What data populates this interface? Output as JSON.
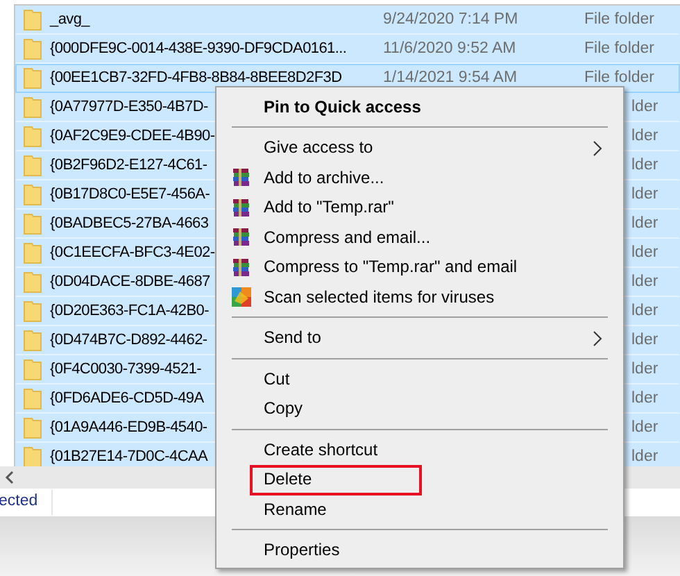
{
  "files": [
    {
      "name": "_avg_",
      "date": "9/24/2020 7:14 PM",
      "type": "File folder",
      "selected": true,
      "focused": false
    },
    {
      "name": "{000DFE9C-0014-438E-9390-DF9CDA0161...",
      "date": "11/6/2020 9:52 AM",
      "type": "File folder",
      "selected": true,
      "focused": false
    },
    {
      "name": "{00EE1CB7-32FD-4FB8-8B84-8BEE8D2F3D",
      "date": "1/14/2021 9:54 AM",
      "type": "File folder",
      "selected": true,
      "focused": true
    },
    {
      "name": "{0A77977D-E350-4B7D-",
      "type": "lder",
      "selected": true,
      "focused": false
    },
    {
      "name": "{0AF2C9E9-CDEE-4B90-",
      "type": "lder",
      "selected": true,
      "focused": false
    },
    {
      "name": "{0B2F96D2-E127-4C61-",
      "type": "lder",
      "selected": true,
      "focused": false
    },
    {
      "name": "{0B17D8C0-E5E7-456A-",
      "type": "lder",
      "selected": true,
      "focused": false
    },
    {
      "name": "{0BADBEC5-27BA-4663",
      "type": "lder",
      "selected": true,
      "focused": false
    },
    {
      "name": "{0C1EECFA-BFC3-4E02-",
      "type": "lder",
      "selected": true,
      "focused": false
    },
    {
      "name": "{0D04DACE-8DBE-4687",
      "type": "lder",
      "selected": true,
      "focused": false
    },
    {
      "name": "{0D20E363-FC1A-42B0-",
      "type": "lder",
      "selected": true,
      "focused": false
    },
    {
      "name": "{0D474B7C-D892-4462-",
      "type": "lder",
      "selected": true,
      "focused": false
    },
    {
      "name": "{0F4C0030-7399-4521-",
      "type": "lder",
      "selected": true,
      "focused": false
    },
    {
      "name": "{0FD6ADE6-CD5D-49A",
      "type": "lder",
      "selected": true,
      "focused": false
    },
    {
      "name": "{01A9A446-ED9B-4540-",
      "type": "lder",
      "selected": true,
      "focused": false
    },
    {
      "name": "{01B27E14-7D0C-4CAA",
      "type": "lder",
      "selected": true,
      "focused": false
    }
  ],
  "status_bar": {
    "text": "ected"
  },
  "context_menu": [
    {
      "kind": "item",
      "label": "Pin to Quick access",
      "bold": true,
      "submenu": false,
      "marked": false
    },
    {
      "kind": "separator"
    },
    {
      "kind": "item",
      "label": "Give access to",
      "bold": false,
      "submenu": true,
      "marked": false
    },
    {
      "kind": "archive",
      "label": "Add to archive...",
      "bold": false,
      "submenu": false,
      "marked": false
    },
    {
      "kind": "archive",
      "label": "Add to \"Temp.rar\"",
      "bold": false,
      "submenu": false,
      "marked": false
    },
    {
      "kind": "archive",
      "label": "Compress and email...",
      "bold": false,
      "submenu": false,
      "marked": false
    },
    {
      "kind": "archive",
      "label": "Compress to \"Temp.rar\" and email",
      "bold": false,
      "submenu": false,
      "marked": false
    },
    {
      "kind": "scan",
      "label": "Scan selected items for viruses",
      "bold": false,
      "submenu": false,
      "marked": false
    },
    {
      "kind": "separator"
    },
    {
      "kind": "item",
      "label": "Send to",
      "bold": false,
      "submenu": true,
      "marked": false
    },
    {
      "kind": "separator"
    },
    {
      "kind": "item",
      "label": "Cut",
      "bold": false,
      "submenu": false,
      "marked": false
    },
    {
      "kind": "item",
      "label": "Copy",
      "bold": false,
      "submenu": false,
      "marked": false
    },
    {
      "kind": "separator"
    },
    {
      "kind": "item",
      "label": "Create shortcut",
      "bold": false,
      "submenu": false,
      "marked": false
    },
    {
      "kind": "item",
      "label": "Delete",
      "bold": false,
      "submenu": false,
      "marked": true
    },
    {
      "kind": "item",
      "label": "Rename",
      "bold": false,
      "submenu": false,
      "marked": false
    },
    {
      "kind": "separator"
    },
    {
      "kind": "item",
      "label": "Properties",
      "bold": false,
      "submenu": false,
      "marked": false
    }
  ]
}
